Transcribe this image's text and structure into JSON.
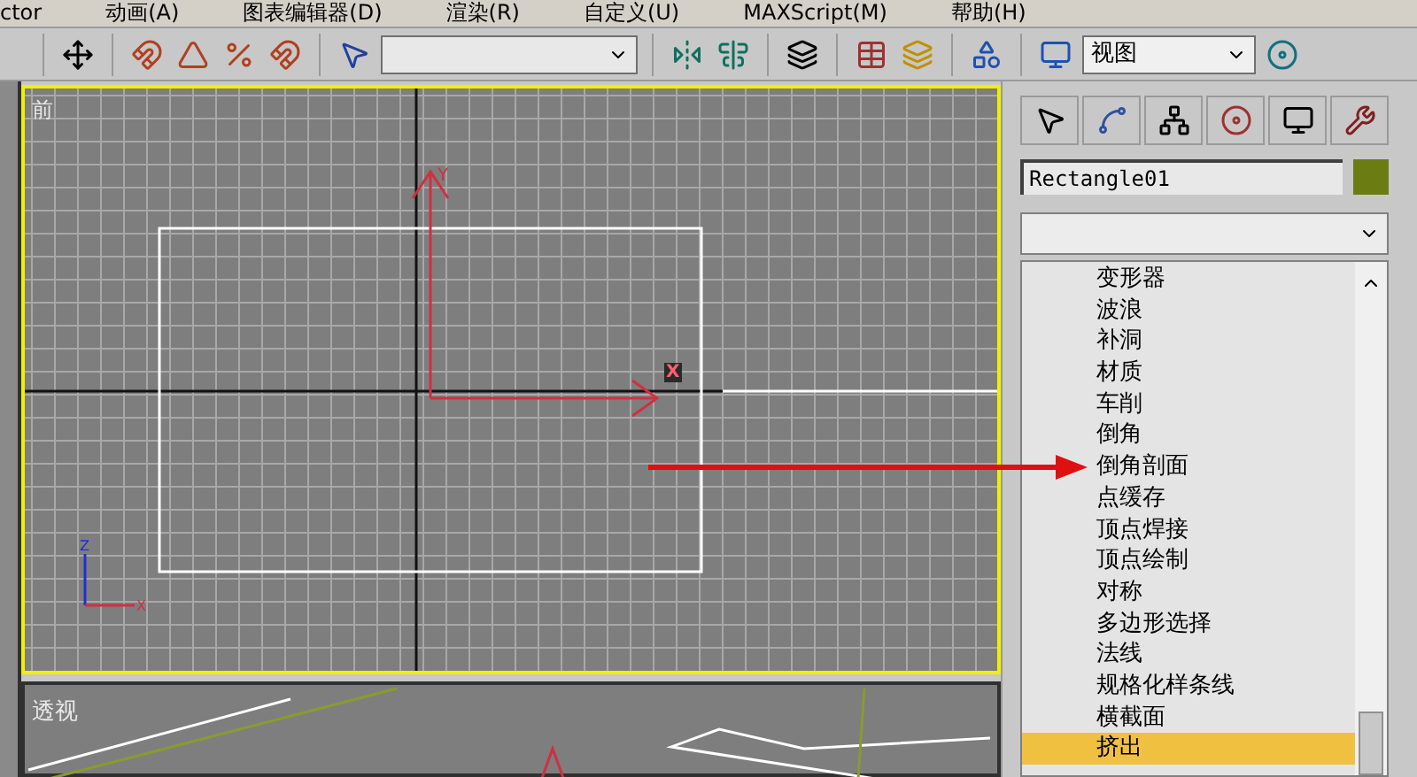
{
  "menu_bar": [
    "ctor",
    "动画(A)",
    "图表编辑器(D)",
    "渲染(R)",
    "自定义(U)",
    "MAXScript(M)",
    "帮助(H)"
  ],
  "toolbar": {
    "viewport_select": {
      "value": "视图"
    }
  },
  "front_viewport": {
    "label": "前",
    "active": true,
    "gizmo_x": "X",
    "gizmo_y": "Y",
    "tripod_z": "Z",
    "tripod_x": "X"
  },
  "perspective_viewport": {
    "label": "透视",
    "active": false
  },
  "command_panel": {
    "object_name": "Rectangle01",
    "modifiers": [
      {
        "label": "变形器",
        "selected": false
      },
      {
        "label": "波浪",
        "selected": false
      },
      {
        "label": "补洞",
        "selected": false
      },
      {
        "label": "材质",
        "selected": false
      },
      {
        "label": "车削",
        "selected": false
      },
      {
        "label": "倒角",
        "selected": false
      },
      {
        "label": "倒角剖面",
        "selected": false
      },
      {
        "label": "点缓存",
        "selected": false
      },
      {
        "label": "顶点焊接",
        "selected": false
      },
      {
        "label": "顶点绘制",
        "selected": false
      },
      {
        "label": "对称",
        "selected": false
      },
      {
        "label": "多边形选择",
        "selected": false
      },
      {
        "label": "法线",
        "selected": false
      },
      {
        "label": "规格化样条线",
        "selected": false
      },
      {
        "label": "横截面",
        "selected": false
      },
      {
        "label": "挤出",
        "selected": true
      }
    ]
  }
}
